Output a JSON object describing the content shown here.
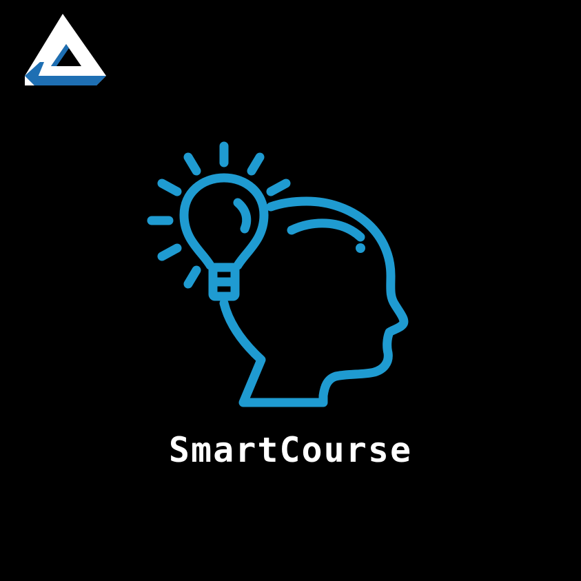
{
  "brand": {
    "name": "SmartCourse"
  },
  "icons": {
    "corner_logo": "triangle-logo-icon",
    "main": "head-lightbulb-icon"
  },
  "colors": {
    "background": "#000000",
    "accent": "#1f9bd1",
    "logo_white": "#ffffff",
    "logo_blue": "#1e6fb3",
    "text": "#ffffff"
  }
}
